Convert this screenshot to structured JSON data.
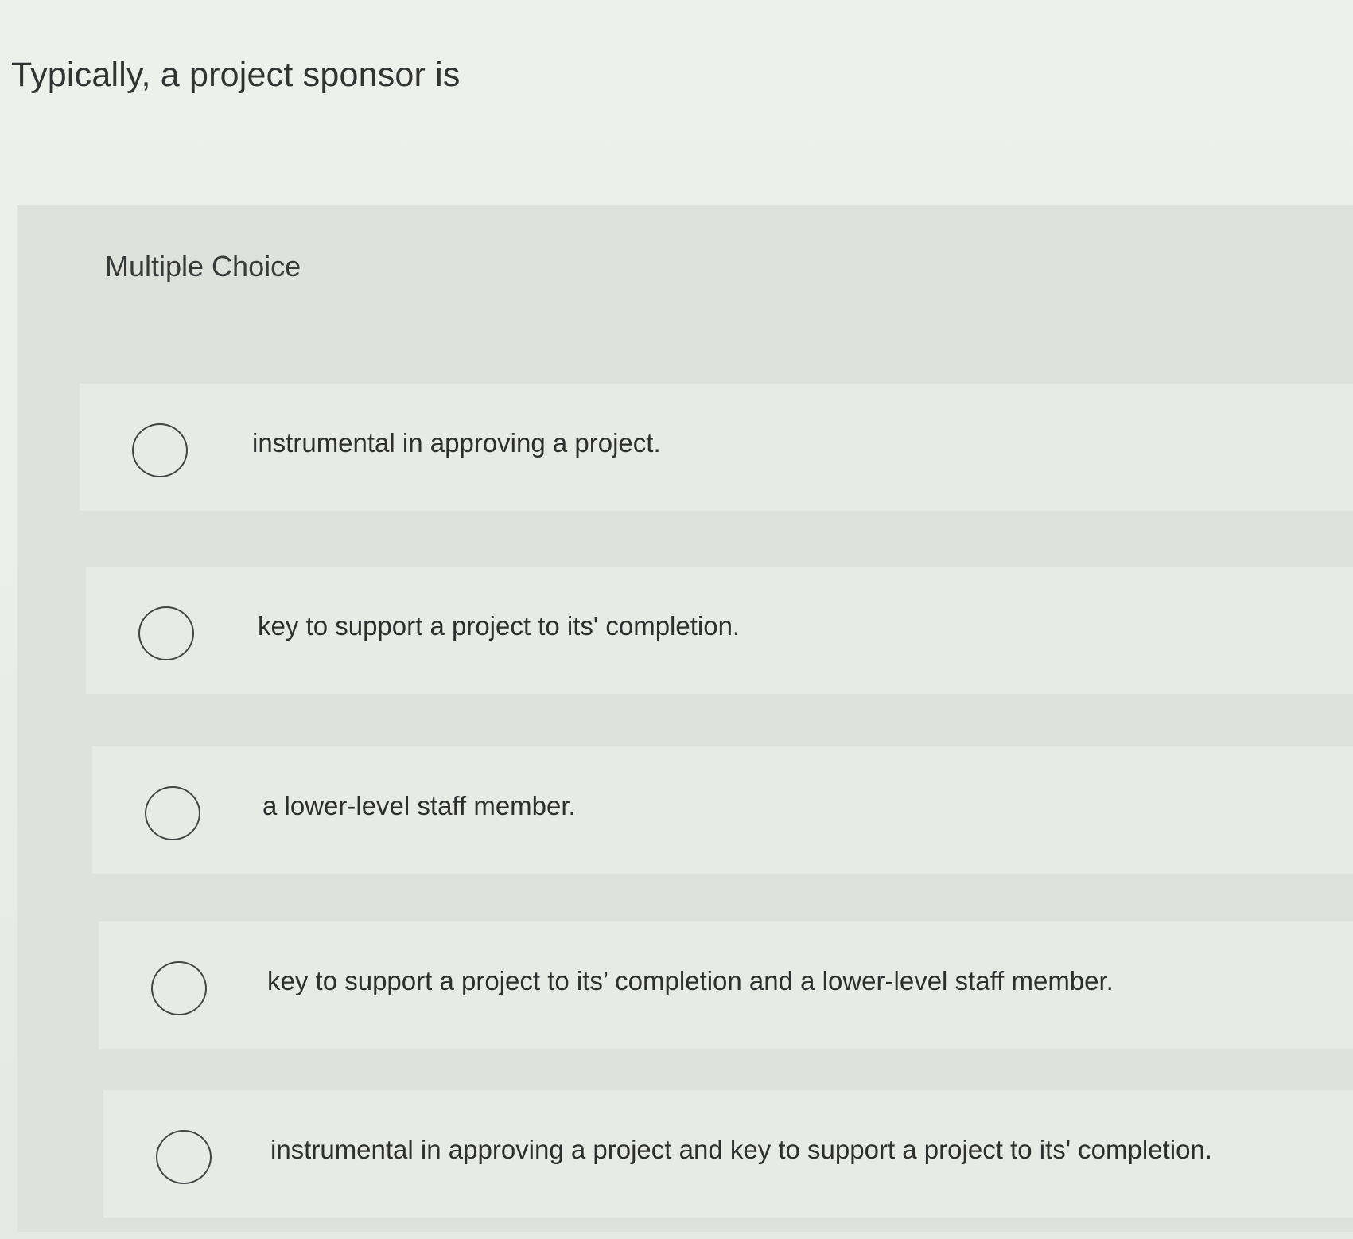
{
  "question": {
    "text": "Typically, a project sponsor is"
  },
  "panel": {
    "header": "Multiple Choice"
  },
  "options": [
    {
      "label": "instrumental in approving a project.",
      "selected": false
    },
    {
      "label": "key to support a project to its' completion.",
      "selected": false
    },
    {
      "label": "a lower-level staff member.",
      "selected": false
    },
    {
      "label": "key to support a project to its’ completion and a lower-level staff member.",
      "selected": false
    },
    {
      "label": "instrumental in approving a project and key to support a project to its' completion.",
      "selected": false
    }
  ]
}
